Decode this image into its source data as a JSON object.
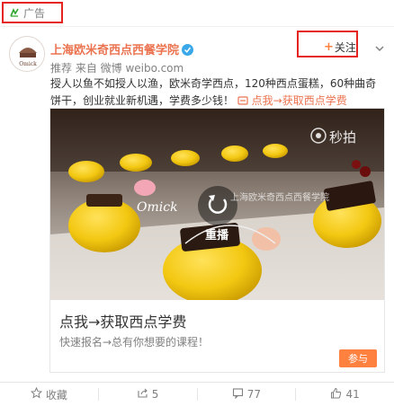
{
  "ad": {
    "label": "广告"
  },
  "account": {
    "name": "上海欧米奇西点西餐学院",
    "source_prefix": "推荐 来自 微博",
    "source_url_text": "weibo.com"
  },
  "follow": {
    "label": "关注"
  },
  "post": {
    "text": "授人以鱼不如授人以渔，欧米奇学西点，120种西点蛋糕，60种曲奇饼干，创业就业新机遇，学费多少钱！",
    "link_text": "点我→获取西点学费"
  },
  "video": {
    "watermark": "秒拍",
    "brand": "Omick",
    "replay_label": "重播",
    "overlay_text": "上海欧米奇西点西餐学院"
  },
  "card": {
    "title": "点我→获取西点学费",
    "subtitle": "快速报名→总有你想要的课程！",
    "button": "参与"
  },
  "toolbar": {
    "favorite": "收藏",
    "share": "5",
    "comment": "77",
    "like": "41"
  },
  "colors": {
    "accent": "#eb7350",
    "highlight_border": "#e5231f",
    "button": "#ff8140",
    "verified": "#3aa8e8"
  }
}
